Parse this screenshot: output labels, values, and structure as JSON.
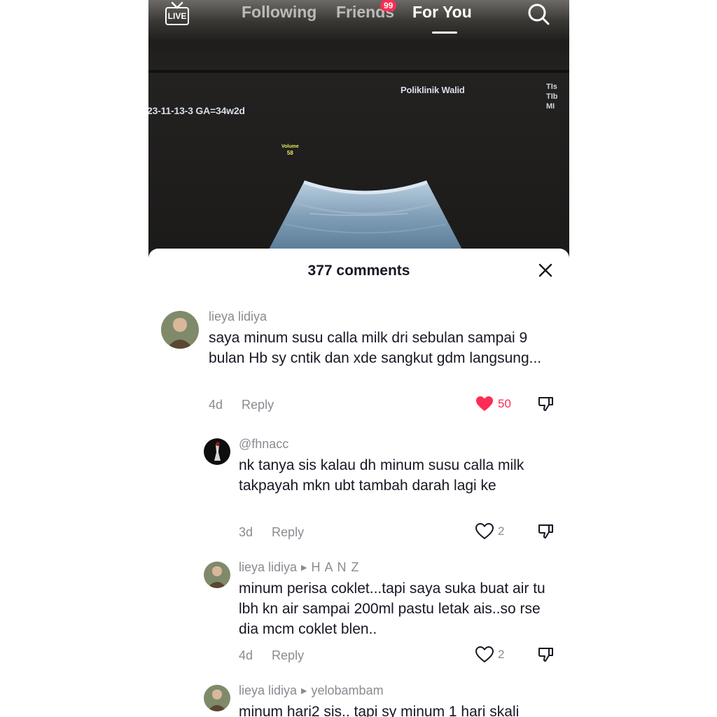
{
  "nav": {
    "live_label": "LIVE",
    "tabs": [
      {
        "label": "Following"
      },
      {
        "label": "Friends"
      },
      {
        "label": "For You"
      }
    ],
    "friends_badge": "99"
  },
  "video": {
    "clinic": "Poliklinik Walid",
    "date_ga": "23-11-13-3  GA=34w2d",
    "side_labels": "TIs\nTIb\nMI",
    "volume_label": "Volume",
    "volume_value": "58"
  },
  "comments_sheet": {
    "title": "377 comments",
    "comments": [
      {
        "user": "lieya lidiya",
        "text": "saya minum susu calla milk dri sebulan sampai 9 bulan Hb sy cntik dan xde sangkut gdm langsung...",
        "time": "4d",
        "reply": "Reply",
        "likes": "50",
        "liked": true
      },
      {
        "user": "@fhnacc",
        "text": "nk tanya sis kalau dh minum susu calla milk takpayah mkn ubt tambah darah lagi ke",
        "time": "3d",
        "reply": "Reply",
        "likes": "2",
        "liked": false
      },
      {
        "user": "lieya lidiya",
        "reply_to": "H A N Z",
        "text": "minum perisa coklet...tapi saya suka buat air tu lbh kn air sampai 200ml pastu letak ais..so rse dia mcm coklet blen..",
        "time": "4d",
        "reply": "Reply",
        "likes": "2",
        "liked": false
      },
      {
        "user": "lieya lidiya",
        "reply_to": "yelobambam",
        "text": "minum hari2 sis.. tapi sy minum 1 hari skali"
      }
    ]
  },
  "colors": {
    "accent": "#fe2c55",
    "text_primary": "#161823",
    "text_secondary": "#8a8b91"
  }
}
